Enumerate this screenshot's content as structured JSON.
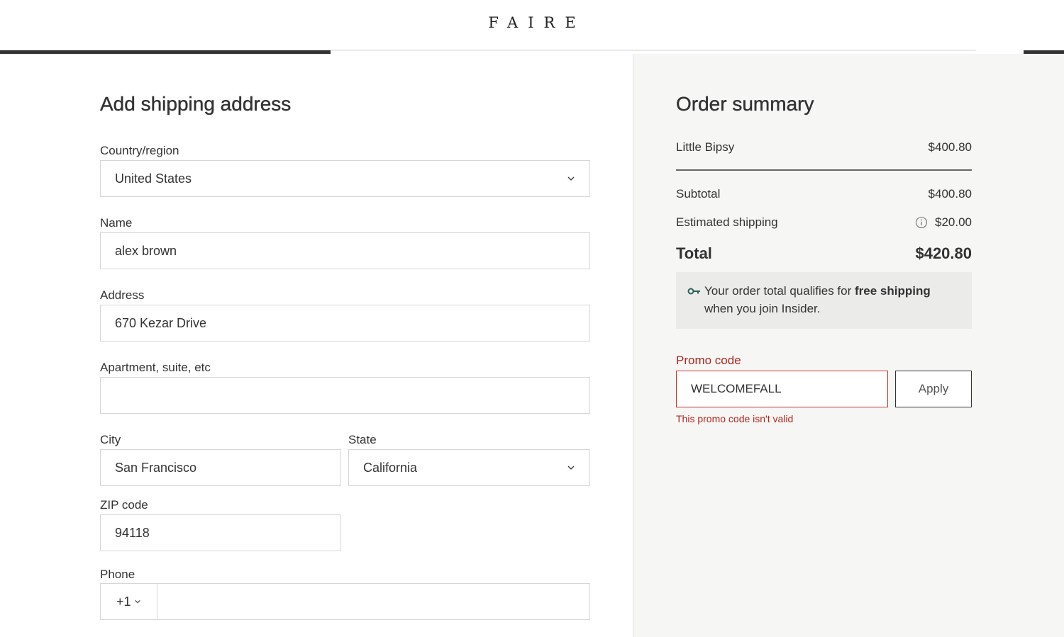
{
  "header": {
    "logo": "FAIRE",
    "progress_fraction": 0.31
  },
  "shipping_form": {
    "title": "Add shipping address",
    "country": {
      "label": "Country/region",
      "value": "United States"
    },
    "name": {
      "label": "Name",
      "value": "alex brown"
    },
    "address": {
      "label": "Address",
      "value": "670 Kezar Drive"
    },
    "apartment": {
      "label": "Apartment, suite, etc",
      "value": ""
    },
    "city": {
      "label": "City",
      "value": "San Francisco"
    },
    "state": {
      "label": "State",
      "value": "California"
    },
    "zip": {
      "label": "ZIP code",
      "value": "94118"
    },
    "phone": {
      "label": "Phone",
      "code": "+1",
      "value": ""
    }
  },
  "order_summary": {
    "title": "Order summary",
    "line_items": [
      {
        "name": "Little Bipsy",
        "price": "$400.80"
      }
    ],
    "subtotal": {
      "label": "Subtotal",
      "value": "$400.80"
    },
    "shipping": {
      "label": "Estimated shipping",
      "value": "$20.00",
      "icon": "info-icon"
    },
    "total": {
      "label": "Total",
      "value": "$420.80"
    },
    "insider": {
      "icon": "key-icon",
      "text_before": "Your order total qualifies for ",
      "text_bold": "free shipping",
      "text_after": " when you join Insider."
    },
    "promo": {
      "label": "Promo code",
      "value": "WELCOMEFALL",
      "button": "Apply",
      "error": "This promo code isn't valid"
    }
  },
  "colors": {
    "text": "#333333",
    "error": "#b3261e",
    "summary_bg": "#f6f6f5",
    "insider_bg": "#ebecea"
  }
}
